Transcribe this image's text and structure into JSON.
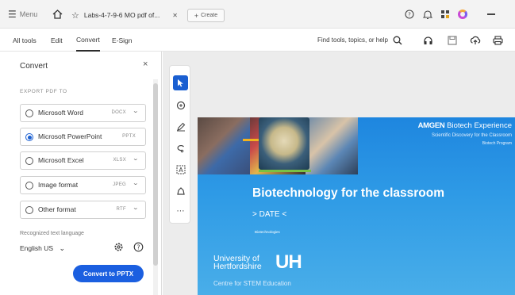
{
  "titlebar": {
    "menu_label": "Menu",
    "tab_title": "Labs-4-7-9-6 MO pdf of...",
    "new_tab_label": "Create"
  },
  "menubar": {
    "tabs": [
      "All tools",
      "Edit",
      "Convert",
      "E-Sign"
    ],
    "active_tab": "Convert",
    "search_label": "Find tools, topics, or help"
  },
  "panel": {
    "title": "Convert",
    "section_label": "EXPORT PDF TO",
    "options": [
      {
        "label": "Microsoft Word",
        "ext": "DOCX",
        "selected": false
      },
      {
        "label": "Microsoft PowerPoint",
        "ext": "PPTX",
        "selected": true
      },
      {
        "label": "Microsoft Excel",
        "ext": "XLSX",
        "selected": false
      },
      {
        "label": "Image format",
        "ext": "JPEG",
        "selected": false
      },
      {
        "label": "Other format",
        "ext": "RTF",
        "selected": false
      }
    ],
    "language_label": "Recognized text language",
    "language_value": "English US",
    "convert_button": "Convert to PPTX"
  },
  "slide": {
    "brand_bold": "AMGEN",
    "brand_rest": " Biotech Experience",
    "brand_sub1": "Scientific Discovery for the Classroom",
    "brand_sub2": "Biotech Program",
    "title": "Biotechnology for the classroom",
    "date": "> DATE <",
    "small_text": "Biotechnologies",
    "university_line1": "University of",
    "university_line2": "Hertfordshire",
    "uh_mark": "UH",
    "university_sub": "Centre for STEM Education"
  },
  "colors": {
    "accent_blue": "#1b5fe0",
    "slide_blue": "#1e86df"
  }
}
